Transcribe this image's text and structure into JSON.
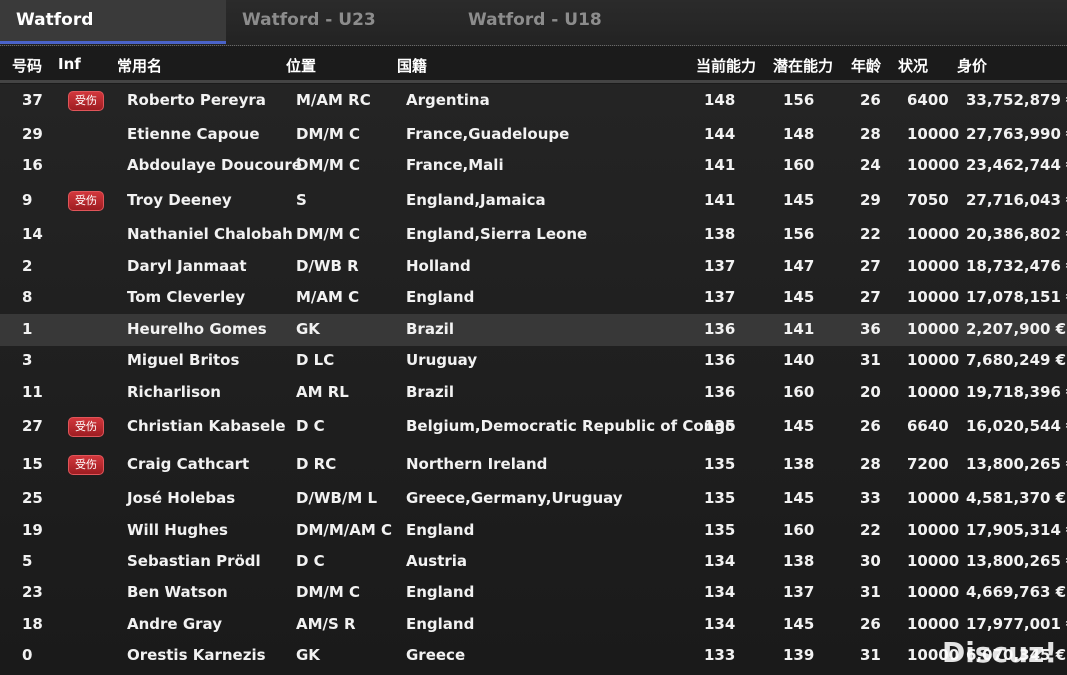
{
  "tabs": [
    {
      "label": "Watford",
      "active": true
    },
    {
      "label": "Watford - U23",
      "active": false
    },
    {
      "label": "Watford - U18",
      "active": false
    }
  ],
  "columns": {
    "number": "号码",
    "inf": "Inf",
    "name": "常用名",
    "position": "位置",
    "nationality": "国籍",
    "ca": "当前能力",
    "pa": "潜在能力",
    "age": "年龄",
    "condition": "状况",
    "value": "身价"
  },
  "injury_label": "受伤",
  "colors": {
    "tab_accent": "#4a63c9",
    "injury_badge": "#c0282d"
  },
  "players": [
    {
      "number": "37",
      "injured": true,
      "name": "Roberto Pereyra",
      "position": "M/AM RC",
      "nationality": "Argentina",
      "ca": "148",
      "pa": "156",
      "age": "26",
      "condition": "6400",
      "value": "33,752,879 €"
    },
    {
      "number": "29",
      "injured": false,
      "name": "Etienne Capoue",
      "position": "DM/M C",
      "nationality": "France,Guadeloupe",
      "ca": "144",
      "pa": "148",
      "age": "28",
      "condition": "10000",
      "value": "27,763,990 €"
    },
    {
      "number": "16",
      "injured": false,
      "name": "Abdoulaye Doucouré",
      "position": "DM/M C",
      "nationality": "France,Mali",
      "ca": "141",
      "pa": "160",
      "age": "24",
      "condition": "10000",
      "value": "23,462,744 €"
    },
    {
      "number": "9",
      "injured": true,
      "name": "Troy Deeney",
      "position": "S",
      "nationality": "England,Jamaica",
      "ca": "141",
      "pa": "145",
      "age": "29",
      "condition": "7050",
      "value": "27,716,043 €"
    },
    {
      "number": "14",
      "injured": false,
      "name": "Nathaniel Chalobah",
      "position": "DM/M C",
      "nationality": "England,Sierra Leone",
      "ca": "138",
      "pa": "156",
      "age": "22",
      "condition": "10000",
      "value": "20,386,802 €"
    },
    {
      "number": "2",
      "injured": false,
      "name": "Daryl Janmaat",
      "position": "D/WB R",
      "nationality": "Holland",
      "ca": "137",
      "pa": "147",
      "age": "27",
      "condition": "10000",
      "value": "18,732,476 €"
    },
    {
      "number": "8",
      "injured": false,
      "name": "Tom Cleverley",
      "position": "M/AM C",
      "nationality": "England",
      "ca": "137",
      "pa": "145",
      "age": "27",
      "condition": "10000",
      "value": "17,078,151 €"
    },
    {
      "number": "1",
      "injured": false,
      "selected": true,
      "name": "Heurelho Gomes",
      "position": "GK",
      "nationality": "Brazil",
      "ca": "136",
      "pa": "141",
      "age": "36",
      "condition": "10000",
      "value": "2,207,900 €"
    },
    {
      "number": "3",
      "injured": false,
      "name": "Miguel Britos",
      "position": "D LC",
      "nationality": "Uruguay",
      "ca": "136",
      "pa": "140",
      "age": "31",
      "condition": "10000",
      "value": "7,680,249 €"
    },
    {
      "number": "11",
      "injured": false,
      "name": "Richarlison",
      "position": "AM RL",
      "nationality": "Brazil",
      "ca": "136",
      "pa": "160",
      "age": "20",
      "condition": "10000",
      "value": "19,718,396 €"
    },
    {
      "number": "27",
      "injured": true,
      "name": "Christian Kabasele",
      "position": "D C",
      "nationality": "Belgium,Democratic Republic of Congo",
      "ca": "135",
      "pa": "145",
      "age": "26",
      "condition": "6640",
      "value": "16,020,544 €"
    },
    {
      "number": "15",
      "injured": true,
      "name": "Craig Cathcart",
      "position": "D RC",
      "nationality": "Northern Ireland",
      "ca": "135",
      "pa": "138",
      "age": "28",
      "condition": "7200",
      "value": "13,800,265 €"
    },
    {
      "number": "25",
      "injured": false,
      "name": "José Holebas",
      "position": "D/WB/M L",
      "nationality": "Greece,Germany,Uruguay",
      "ca": "135",
      "pa": "145",
      "age": "33",
      "condition": "10000",
      "value": "4,581,370 €"
    },
    {
      "number": "19",
      "injured": false,
      "name": "Will Hughes",
      "position": "DM/M/AM C",
      "nationality": "England",
      "ca": "135",
      "pa": "160",
      "age": "22",
      "condition": "10000",
      "value": "17,905,314 €"
    },
    {
      "number": "5",
      "injured": false,
      "name": "Sebastian Prödl",
      "position": "D C",
      "nationality": "Austria",
      "ca": "134",
      "pa": "138",
      "age": "30",
      "condition": "10000",
      "value": "13,800,265 €"
    },
    {
      "number": "23",
      "injured": false,
      "name": "Ben Watson",
      "position": "DM/M C",
      "nationality": "England",
      "ca": "134",
      "pa": "137",
      "age": "31",
      "condition": "10000",
      "value": "4,669,763 €"
    },
    {
      "number": "18",
      "injured": false,
      "name": "Andre Gray",
      "position": "AM/S R",
      "nationality": "England",
      "ca": "134",
      "pa": "145",
      "age": "26",
      "condition": "10000",
      "value": "17,977,001 €"
    },
    {
      "number": "0",
      "injured": false,
      "name": "Orestis Karnezis",
      "position": "GK",
      "nationality": "Greece",
      "ca": "133",
      "pa": "139",
      "age": "31",
      "condition": "10000",
      "value": "6,070,345 €"
    }
  ],
  "watermark": "Discuz!"
}
